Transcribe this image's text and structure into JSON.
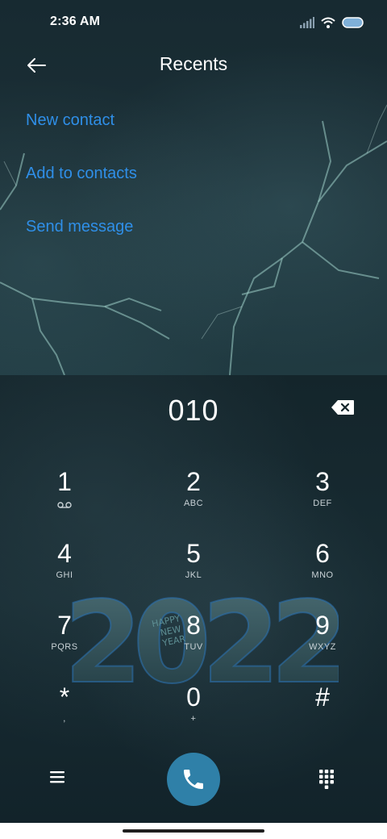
{
  "status_bar": {
    "time": "2:36 AM",
    "icons": [
      "signal-icon",
      "wifi-icon",
      "battery-icon"
    ]
  },
  "header": {
    "title": "Recents",
    "back_icon": "back-arrow-icon"
  },
  "actions": [
    {
      "label": "New contact"
    },
    {
      "label": "Add to contacts"
    },
    {
      "label": "Send message"
    }
  ],
  "dialer": {
    "number": "010",
    "backspace_icon": "backspace-icon",
    "keys": [
      {
        "digit": "1",
        "letters": "",
        "sub_icon": "voicemail-icon"
      },
      {
        "digit": "2",
        "letters": "ABC"
      },
      {
        "digit": "3",
        "letters": "DEF"
      },
      {
        "digit": "4",
        "letters": "GHI"
      },
      {
        "digit": "5",
        "letters": "JKL"
      },
      {
        "digit": "6",
        "letters": "MNO"
      },
      {
        "digit": "7",
        "letters": "PQRS"
      },
      {
        "digit": "8",
        "letters": "TUV"
      },
      {
        "digit": "9",
        "letters": "WXYZ"
      },
      {
        "digit": "*",
        "letters": ","
      },
      {
        "digit": "0",
        "letters": "+"
      },
      {
        "digit": "#",
        "letters": ""
      }
    ]
  },
  "bottom_bar": {
    "menu_icon": "menu-icon",
    "call_icon": "phone-icon",
    "keypad_icon": "dialpad-icon"
  },
  "wallpaper": {
    "art_text": "2022",
    "art_subtext": [
      "HAPPY",
      "NEW",
      "YEAR"
    ]
  },
  "colors": {
    "accent_link": "#2f8fe8",
    "call_button": "#2f80a8",
    "background": "#0f1d22"
  }
}
